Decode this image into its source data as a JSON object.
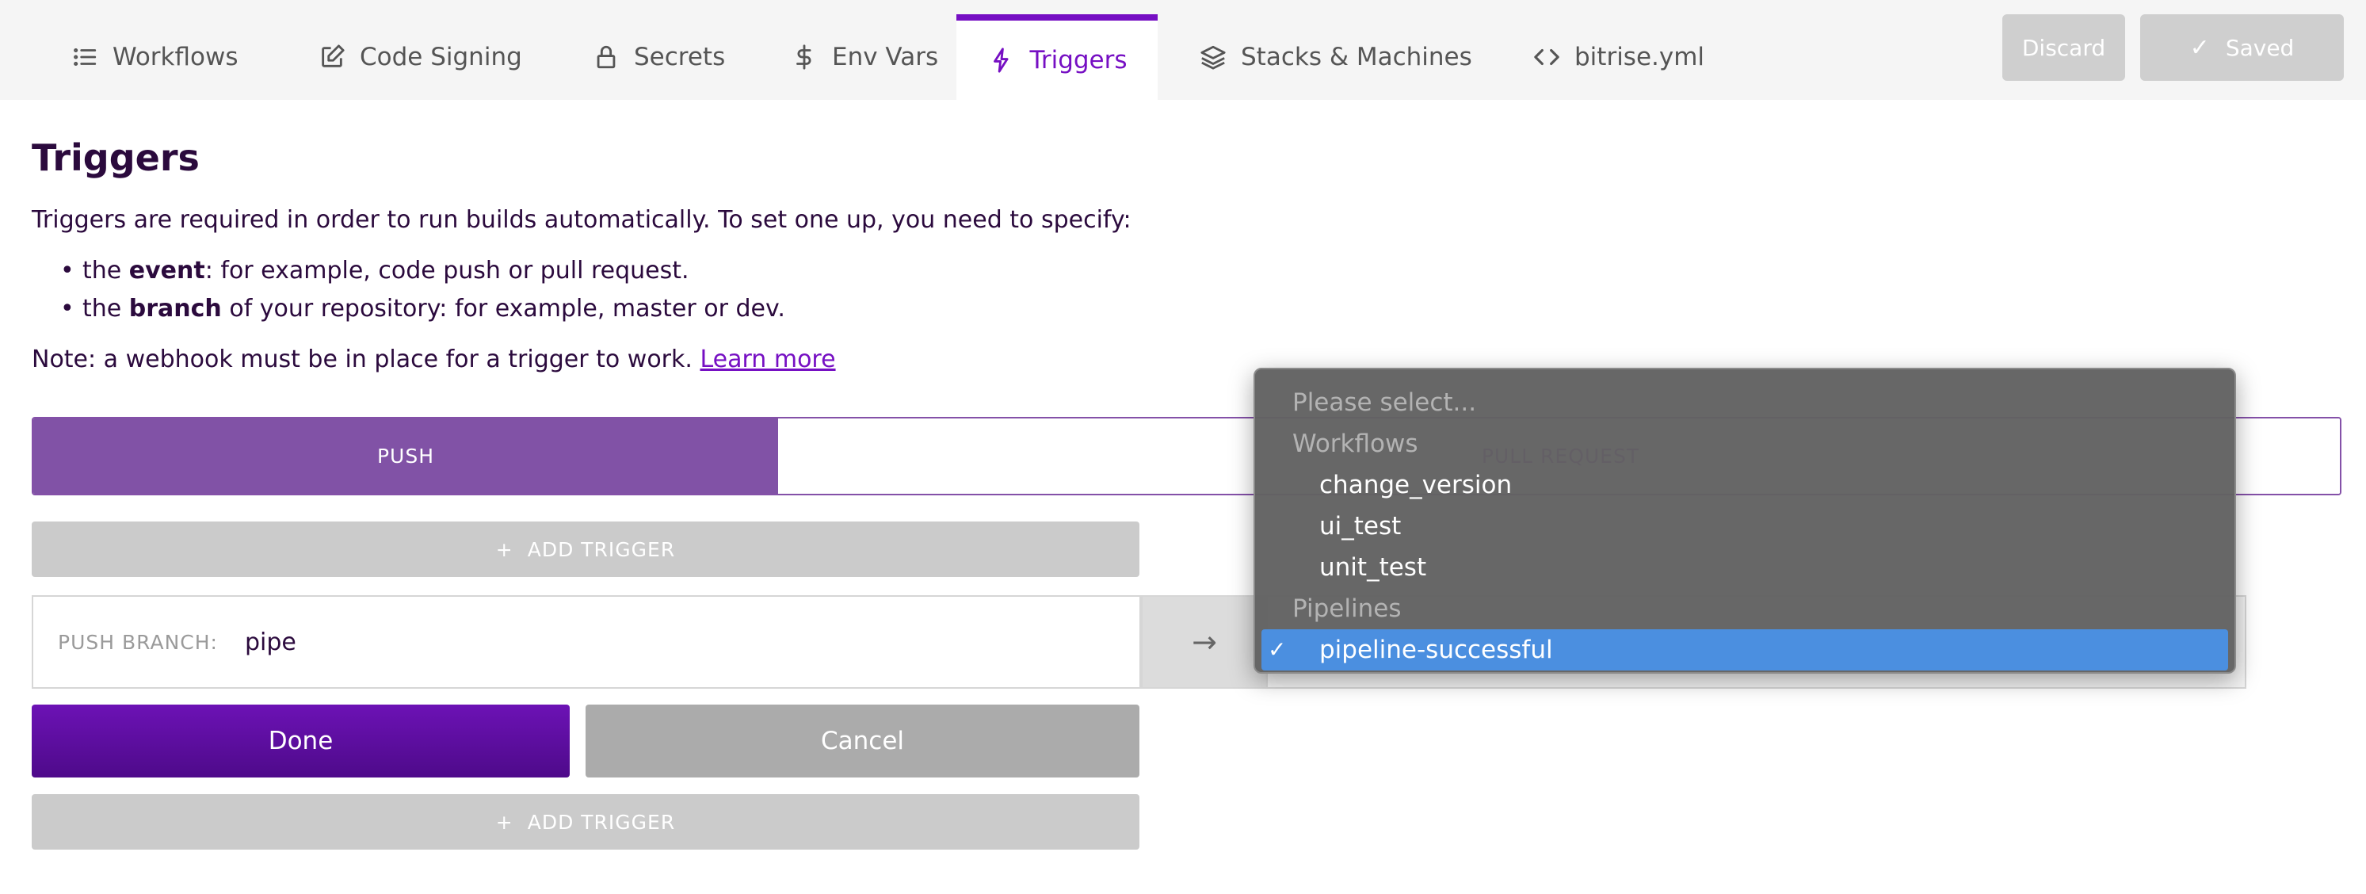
{
  "tabs": [
    {
      "label": "Workflows",
      "icon": "list-icon"
    },
    {
      "label": "Code Signing",
      "icon": "edit-icon"
    },
    {
      "label": "Secrets",
      "icon": "lock-icon"
    },
    {
      "label": "Env Vars",
      "icon": "dollar-icon"
    },
    {
      "label": "Triggers",
      "icon": "bolt-icon",
      "active": true
    },
    {
      "label": "Stacks & Machines",
      "icon": "layers-icon"
    },
    {
      "label": "bitrise.yml",
      "icon": "code-icon"
    }
  ],
  "actions": {
    "discard_label": "Discard",
    "saved_label": "Saved"
  },
  "content": {
    "title": "Triggers",
    "intro": "Triggers are required in order to run builds automatically. To set one up, you need to specify:",
    "bullets": [
      {
        "prefix": "the ",
        "bold": "event",
        "suffix": ": for example, code push or pull request."
      },
      {
        "prefix": "the ",
        "bold": "branch",
        "suffix": " of your repository: for example, master or dev."
      }
    ],
    "note_text": "Note: a webhook must be in place for a trigger to work. ",
    "note_link": "Learn more"
  },
  "segments": {
    "push_label": "PUSH",
    "pull_request_label": "PULL REQUEST"
  },
  "trigger_form": {
    "add_trigger_label": "ADD TRIGGER",
    "branch_label": "PUSH BRANCH:",
    "branch_value": "pipe",
    "arrow": "→",
    "done_label": "Done",
    "cancel_label": "Cancel"
  },
  "dropdown": {
    "placeholder": "Please select...",
    "groups": [
      {
        "label": "Workflows",
        "options": [
          "change_version",
          "ui_test",
          "unit_test"
        ]
      },
      {
        "label": "Pipelines",
        "options": [
          "pipeline-successful"
        ]
      }
    ],
    "selected": "pipeline-successful"
  },
  "colors": {
    "accent": "#760fc3",
    "push_active": "#8152a6",
    "selection": "#4b8fe0"
  }
}
